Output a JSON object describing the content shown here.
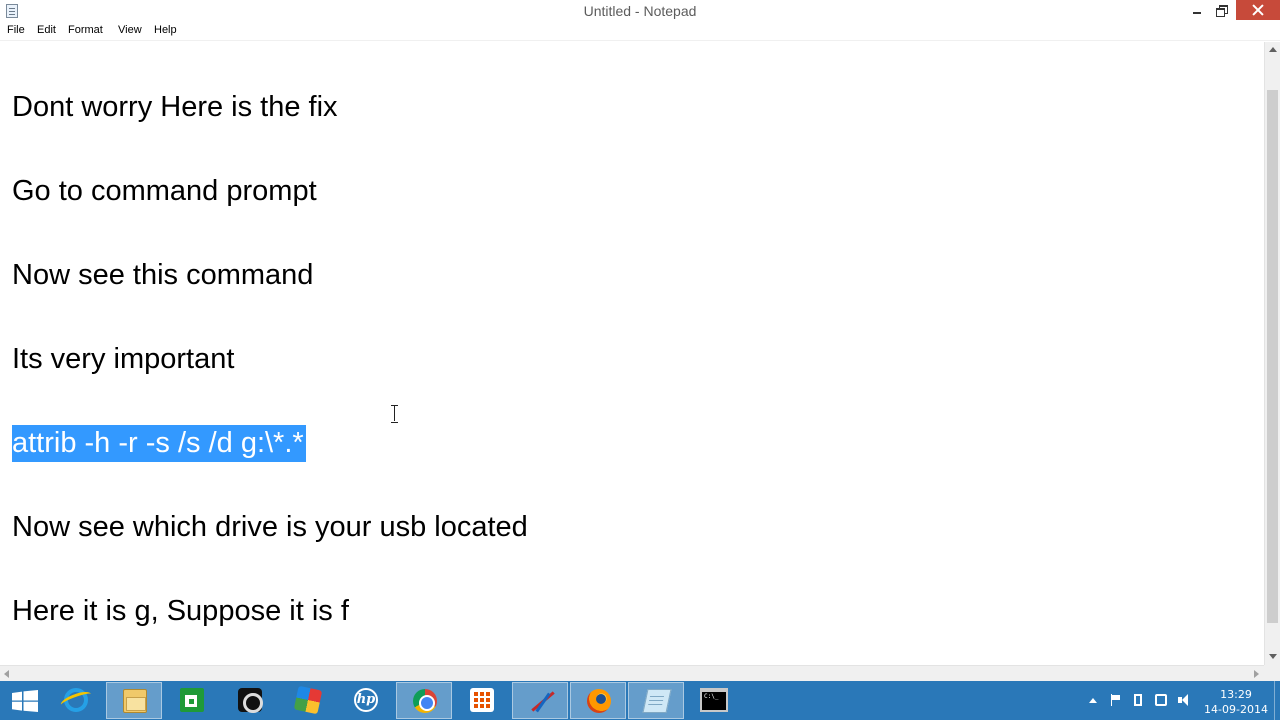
{
  "window": {
    "title": "Untitled - Notepad"
  },
  "menu": {
    "items": [
      "File",
      "Edit",
      "Format",
      "View",
      "Help"
    ]
  },
  "editor": {
    "lines": [
      "Dont worry Here is the fix",
      "Go to command prompt",
      "Now see this command",
      "Its very important",
      "attrib -h -r -s /s /d g:\\*.*",
      "Now see which drive is your usb located",
      "Here it is g, Suppose it is f"
    ],
    "selected_line": "attrib -h -r -s /s /d g:\\*.*",
    "selection_color": "#3399ff"
  },
  "taskbar": {
    "color": "#2a78b8",
    "pinned": [
      {
        "name": "start",
        "icon": "windows-logo-icon"
      },
      {
        "name": "internet-explorer",
        "icon": "internet-explorer-icon"
      },
      {
        "name": "file-explorer",
        "icon": "folder-icon",
        "active": true
      },
      {
        "name": "store",
        "icon": "store-icon"
      },
      {
        "name": "camera",
        "icon": "camera-icon"
      },
      {
        "name": "picasa",
        "icon": "picasa-icon"
      },
      {
        "name": "hp",
        "icon": "hp-icon",
        "text": "hp"
      },
      {
        "name": "chrome",
        "icon": "chrome-icon",
        "active": true
      },
      {
        "name": "apps",
        "icon": "apps-grid-icon"
      },
      {
        "name": "graph",
        "icon": "graph-icon",
        "active": true
      },
      {
        "name": "firefox",
        "icon": "firefox-icon",
        "active": true
      },
      {
        "name": "notepad",
        "icon": "notepad-icon",
        "active": true
      },
      {
        "name": "command-prompt",
        "icon": "command-prompt-icon"
      }
    ],
    "clock": {
      "time": "13:29",
      "date": "14-09-2014"
    }
  }
}
